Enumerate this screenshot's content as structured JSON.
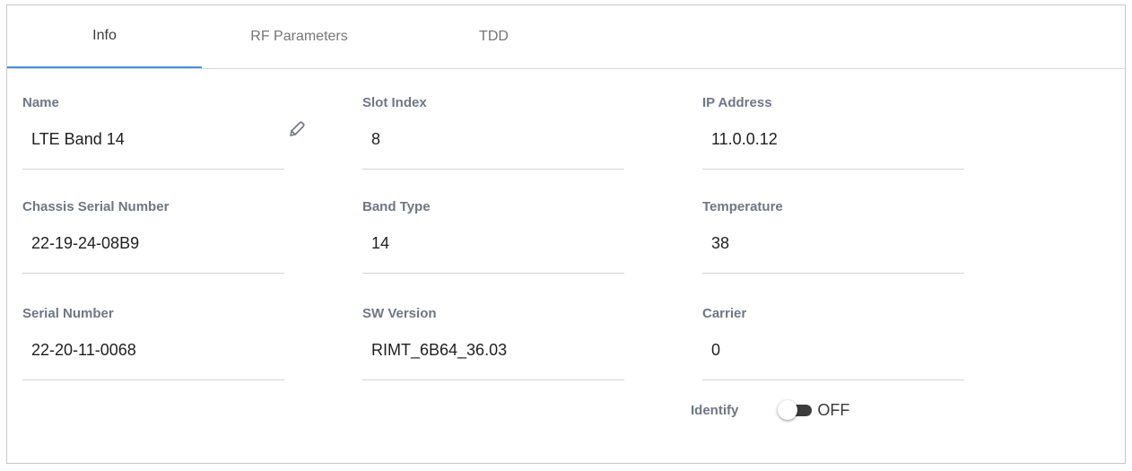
{
  "tabs": [
    {
      "label": "Info",
      "active": true
    },
    {
      "label": "RF Parameters",
      "active": false
    },
    {
      "label": "TDD",
      "active": false
    }
  ],
  "fields": {
    "name": {
      "label": "Name",
      "value": "LTE Band 14"
    },
    "slot_index": {
      "label": "Slot Index",
      "value": "8"
    },
    "ip_address": {
      "label": "IP Address",
      "value": "11.0.0.12"
    },
    "chassis_serial": {
      "label": "Chassis Serial Number",
      "value": "22-19-24-08B9"
    },
    "band_type": {
      "label": "Band Type",
      "value": "14"
    },
    "temperature": {
      "label": "Temperature",
      "value": "38"
    },
    "serial_number": {
      "label": "Serial Number",
      "value": "22-20-11-0068"
    },
    "sw_version": {
      "label": "SW Version",
      "value": "RIMT_6B64_36.03"
    },
    "carrier": {
      "label": "Carrier",
      "value": "0"
    }
  },
  "identify": {
    "label": "Identify",
    "state": "OFF"
  },
  "icons": {
    "edit": "pencil-icon"
  },
  "colors": {
    "accent": "#4a90d9",
    "label": "#6f7684",
    "toggle_track": "#3c3c3c"
  }
}
